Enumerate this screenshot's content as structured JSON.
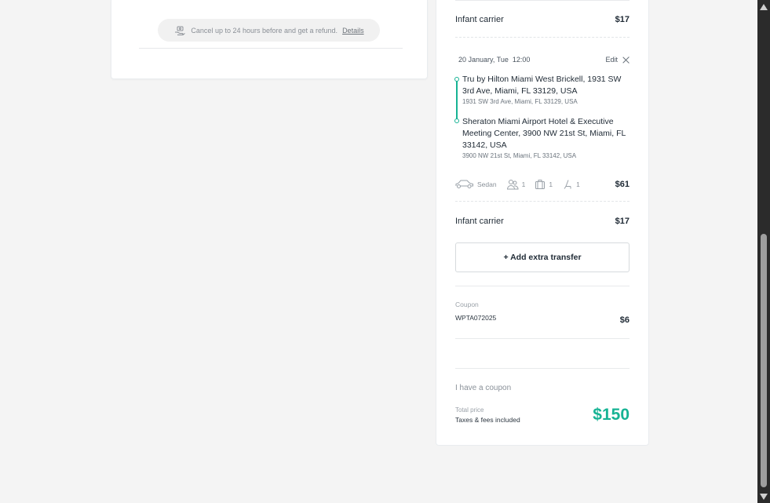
{
  "left_card": {
    "refund_text": "Cancel up to 24 hours before and get a refund.",
    "refund_link": "Details"
  },
  "booking": {
    "extra_1": {
      "label": "Infant carrier",
      "price": "$17"
    },
    "transfer": {
      "date": "20 January, Tue",
      "time": "12:00",
      "edit_label": "Edit",
      "from_main": "Tru by Hilton Miami West Brickell, 1931 SW 3rd Ave, Miami, FL 33129, USA",
      "from_sub": "1931 SW 3rd Ave, Miami, FL 33129, USA",
      "to_main": "Sheraton Miami Airport Hotel & Executive Meeting Center, 3900 NW 21st St, Miami, FL 33142, USA",
      "to_sub": "3900 NW 21st St, Miami, FL 33142, USA",
      "car_type": "Sedan",
      "passengers": "1",
      "luggage": "1",
      "seats": "1",
      "price": "$61"
    },
    "extra_2": {
      "label": "Infant carrier",
      "price": "$17"
    },
    "add_transfer_label": "+ Add extra transfer",
    "coupon": {
      "label": "Coupon",
      "code": "WPTA072025",
      "amount": "$6"
    },
    "have_coupon_label": "I have a coupon",
    "total": {
      "label": "Total price",
      "taxes_label": "Taxes & fees included",
      "amount": "$150"
    }
  },
  "colors": {
    "accent": "#16b394",
    "background": "#f4f4f4"
  }
}
